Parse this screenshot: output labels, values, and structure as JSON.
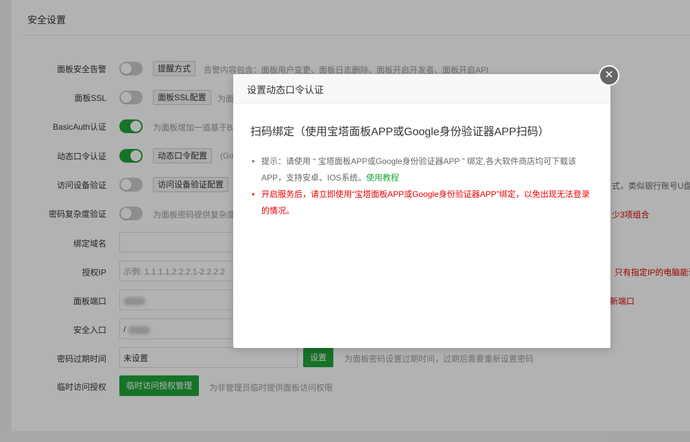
{
  "panel": {
    "title": "安全设置"
  },
  "rows": {
    "alert": {
      "label": "面板安全告警",
      "toggle_on": false,
      "button": "提醒方式",
      "desc": "告警内容包含：面板用户变更、面板日志删除、面板开启开发者、面板开启API"
    },
    "ssl": {
      "label": "面板SSL",
      "toggle_on": false,
      "button": "面板SSL配置",
      "desc": "为面"
    },
    "basicauth": {
      "label": "BasicAuth认证",
      "toggle_on": true,
      "desc": "为面板增加一道基于Ba"
    },
    "totp": {
      "label": "动态口令认证",
      "toggle_on": true,
      "button": "动态口令配置",
      "desc": "(Go"
    },
    "device": {
      "label": "访问设备验证",
      "toggle_on": false,
      "button": "访问设备验证配置",
      "desc_right": "式，类似银行账号U盘"
    },
    "password_complexity": {
      "label": "密码复杂度验证",
      "toggle_on": false,
      "desc": "为面板密码提供复杂度",
      "warn_right": "少3项组合"
    },
    "domain": {
      "label": "绑定域名"
    },
    "auth_ip": {
      "label": "授权IP",
      "placeholder": "示例: 1.1.1.1,2.2.2.1-2.2.2.2",
      "warn_right": "只有指定IP的电脑能访"
    },
    "port": {
      "label": "面板端口",
      "warn_right": "行新端口"
    },
    "entry": {
      "label": "安全入口",
      "value_prefix": "/"
    },
    "pwd_expire": {
      "label": "密码过期时间",
      "value": "未设置",
      "button": "设置",
      "desc": "为面板密码设置过期时间，过期后需要重新设置密码"
    },
    "temp_access": {
      "label": "临时访问授权",
      "button": "临时访问授权管理",
      "desc": "为非管理员临时提供面板访问权限"
    }
  },
  "modal": {
    "title": "设置动态口令认证",
    "close_icon": "close-icon",
    "heading": "扫码绑定（使用宝塔面板APP或Google身份验证器APP扫码）",
    "tip1_text": "提示：请使用 “ 宝塔面板APP或Google身份验证器APP ” 绑定,各大软件商店均可下载该APP，支持安卓、IOS系统。",
    "tip1_link": "使用教程",
    "tip2_text": "开启服务后，请立即使用“宝塔面板APP或Google身份验证器APP”绑定，以免出现无法登录的情况。"
  },
  "colors": {
    "accent": "#20a53a",
    "warn": "#e00000"
  }
}
